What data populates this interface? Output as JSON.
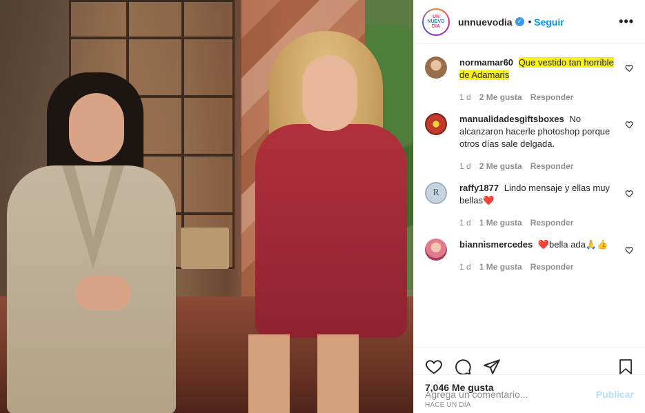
{
  "post": {
    "username": "unnuevodia",
    "logo_text": {
      "line1": "UN",
      "line2": "NUEVO",
      "line3": "DIA"
    },
    "verified_mark": "✓",
    "separator": "•",
    "follow_label": "Seguir",
    "more_label": "•••"
  },
  "comments": [
    {
      "user": "normamar60",
      "text": "Que vestido tan horrible de Adamaris",
      "highlighted": true,
      "age": "1 d",
      "likes": "2 Me gusta",
      "reply": "Responder",
      "avatar_color": "#9a6d4a"
    },
    {
      "user": "manualidadesgiftsboxes",
      "text": "No alcanzaron hacerle photoshop porque otros días sale delgada.",
      "highlighted": false,
      "age": "1 d",
      "likes": "2 Me gusta",
      "reply": "Responder",
      "avatar_color": "#c0392b"
    },
    {
      "user": "raffy1877",
      "text": "Lindo mensaje y ellas muy bellas❤️",
      "highlighted": false,
      "age": "1 d",
      "likes": "1 Me gusta",
      "reply": "Responder",
      "avatar_color": "#9fb3c8",
      "avatar_letter": "R"
    },
    {
      "user": "biannismercedes",
      "text": "❤️bella ada🙏👍",
      "highlighted": false,
      "age": "1 d",
      "likes": "1 Me gusta",
      "reply": "Responder",
      "avatar_color": "#e07a8c"
    }
  ],
  "stats": {
    "likes": "7,046 Me gusta",
    "time": "HACE UN DÍA"
  },
  "add_comment": {
    "placeholder": "Agrega un comentario...",
    "publish_label": "Publicar"
  },
  "icons": {
    "like": "heart-icon",
    "comment": "comment-bubble-icon",
    "share": "paper-plane-icon",
    "save": "bookmark-icon"
  },
  "colors": {
    "follow": "#0095f6",
    "publish_disabled": "#b2dffc",
    "highlight": "#f7f018",
    "muted": "#8e8e8e"
  }
}
